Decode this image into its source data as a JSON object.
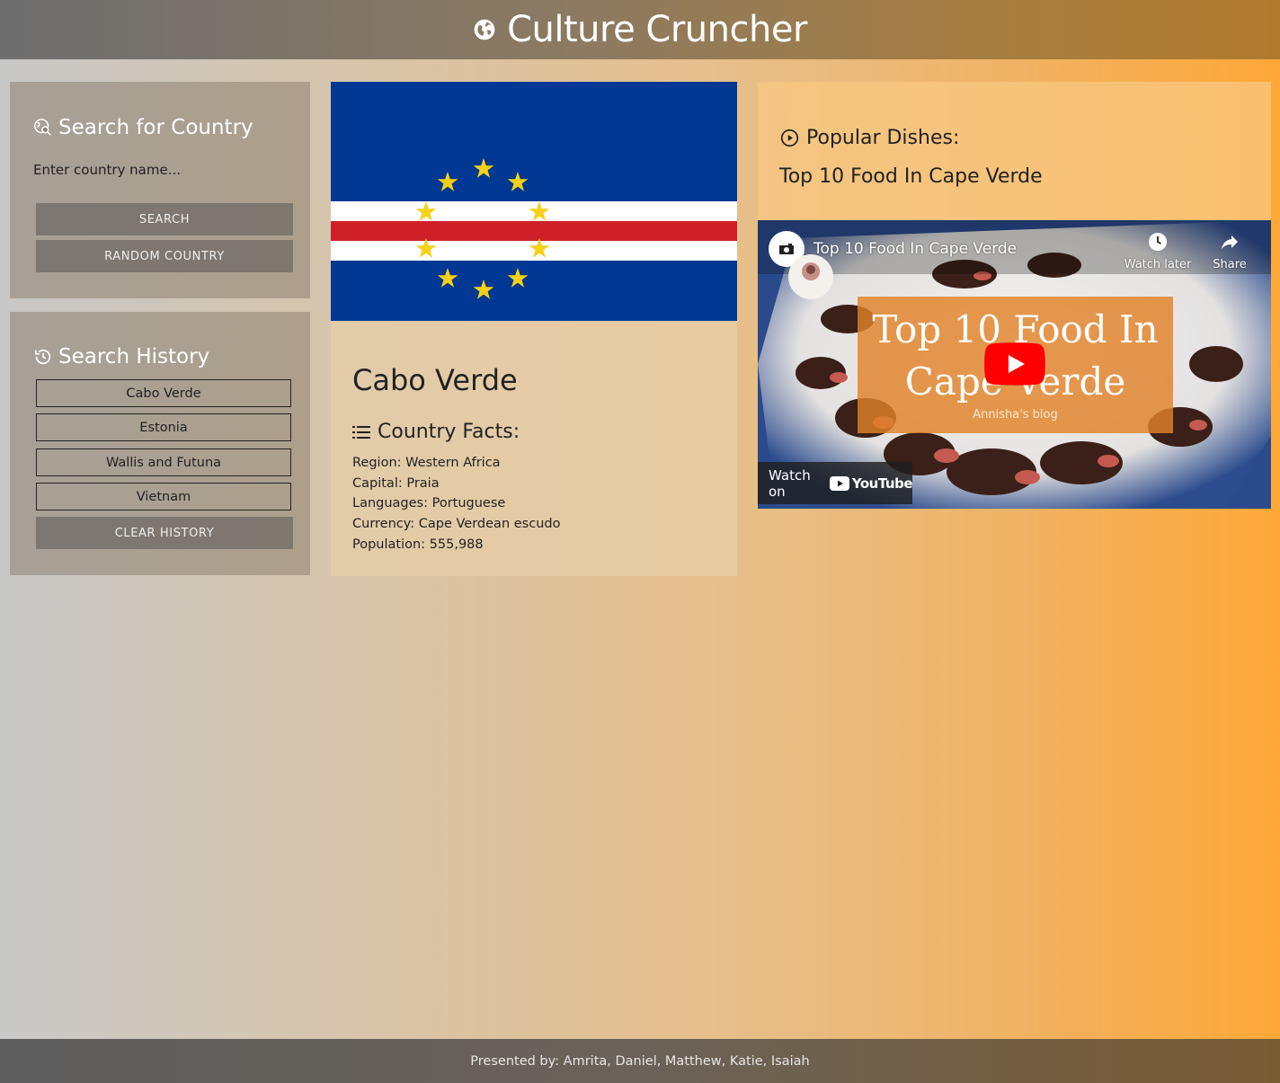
{
  "header": {
    "title": "Culture Cruncher",
    "icon": "globe-icon"
  },
  "search": {
    "heading": "Search for Country",
    "placeholder": "Enter country name...",
    "search_label": "SEARCH",
    "random_label": "RANDOM COUNTRY"
  },
  "history": {
    "heading": "Search History",
    "items": [
      "Cabo Verde",
      "Estonia",
      "Wallis and Futuna",
      "Vietnam"
    ],
    "clear_label": "CLEAR HISTORY"
  },
  "country": {
    "name": "Cabo Verde",
    "facts_heading": "Country Facts:",
    "facts": [
      "Region: Western Africa",
      "Capital: Praia",
      "Languages: Portuguese",
      "Currency: Cape Verdean escudo",
      "Population: 555,988"
    ],
    "flag_colors": {
      "blue": "#003893",
      "white": "#ffffff",
      "red": "#cf2027",
      "star": "#f7d116"
    }
  },
  "dishes": {
    "heading": "Popular Dishes:",
    "video_title": "Top 10 Food In Cape Verde",
    "video": {
      "title": "Top 10 Food In Cape Verde",
      "watch_later": "Watch later",
      "share": "Share",
      "thumb_line1": "Top 10 Food In",
      "thumb_line2": "Cape Verde",
      "thumb_sub": "Annisha's blog",
      "watch_on": "Watch on",
      "youtube": "YouTube"
    }
  },
  "footer": {
    "text": "Presented by: Amrita, Daniel, Matthew, Katie, Isaiah"
  }
}
